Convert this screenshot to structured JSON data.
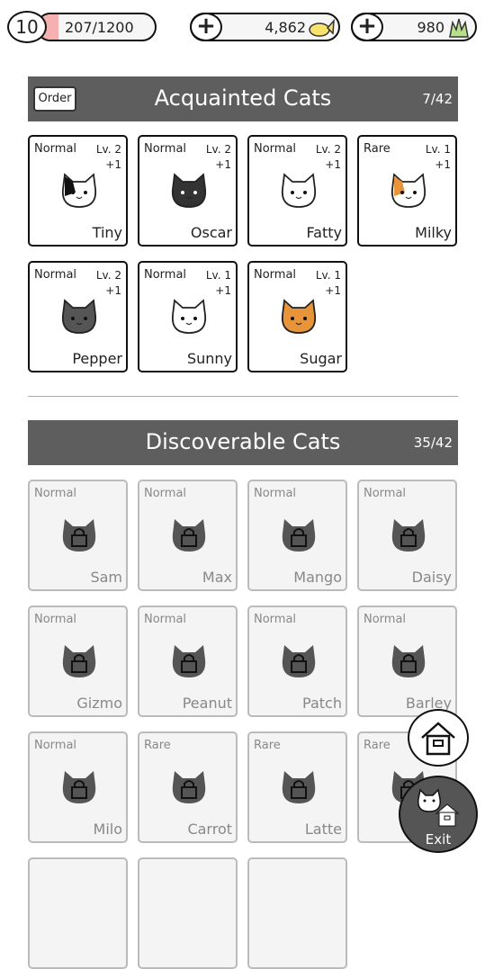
{
  "topbar": {
    "level": "10",
    "xp": "207/1200",
    "xp_progress": 0.1725,
    "fish": "4,862",
    "grass": "980",
    "fish_icon": "fish-icon",
    "grass_icon": "grass-icon"
  },
  "acquainted": {
    "order_label": "Order",
    "title": "Acquainted Cats",
    "count": "7/42",
    "cats": [
      {
        "rarity": "Normal",
        "level": "Lv. 2",
        "plus": "+1",
        "name": "Tiny",
        "color": "#ffffff",
        "spot": "#111111"
      },
      {
        "rarity": "Normal",
        "level": "Lv. 2",
        "plus": "+1",
        "name": "Oscar",
        "color": "#333333",
        "spot": ""
      },
      {
        "rarity": "Normal",
        "level": "Lv. 2",
        "plus": "+1",
        "name": "Fatty",
        "color": "#ffffff",
        "spot": ""
      },
      {
        "rarity": "Rare",
        "level": "Lv. 1",
        "plus": "+1",
        "name": "Milky",
        "color": "#ffffff",
        "spot": "#e8943a"
      },
      {
        "rarity": "Normal",
        "level": "Lv. 2",
        "plus": "+1",
        "name": "Pepper",
        "color": "#555555",
        "spot": ""
      },
      {
        "rarity": "Normal",
        "level": "Lv. 1",
        "plus": "+1",
        "name": "Sunny",
        "color": "#ffffff",
        "spot": ""
      },
      {
        "rarity": "Normal",
        "level": "Lv. 1",
        "plus": "+1",
        "name": "Sugar",
        "color": "#e8943a",
        "spot": ""
      }
    ]
  },
  "discoverable": {
    "title": "Discoverable Cats",
    "count": "35/42",
    "cats": [
      {
        "rarity": "Normal",
        "name": "Sam"
      },
      {
        "rarity": "Normal",
        "name": "Max"
      },
      {
        "rarity": "Normal",
        "name": "Mango"
      },
      {
        "rarity": "Normal",
        "name": "Daisy"
      },
      {
        "rarity": "Normal",
        "name": "Gizmo"
      },
      {
        "rarity": "Normal",
        "name": "Peanut"
      },
      {
        "rarity": "Normal",
        "name": "Patch"
      },
      {
        "rarity": "Normal",
        "name": "Barley"
      },
      {
        "rarity": "Normal",
        "name": "Milo"
      },
      {
        "rarity": "Rare",
        "name": "Carrot"
      },
      {
        "rarity": "Rare",
        "name": "Latte"
      },
      {
        "rarity": "Rare",
        "name": ""
      }
    ]
  },
  "buttons": {
    "exit_label": "Exit"
  }
}
